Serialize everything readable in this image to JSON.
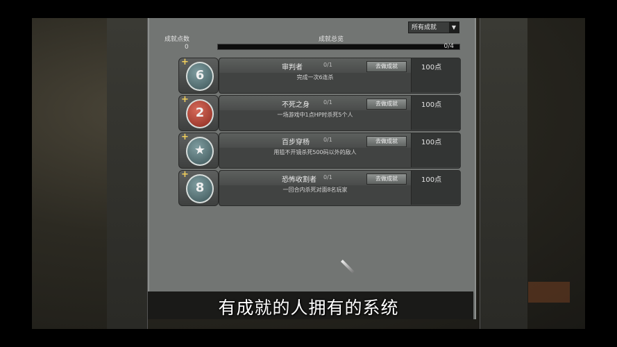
{
  "header": {
    "points_label": "成就点数",
    "points_value": "0",
    "progress_label": "成就总览",
    "progress_text": "0/4",
    "progress_fraction": 0
  },
  "filter": {
    "selected": "所有成就",
    "arrow_icon": "chevron-down-icon"
  },
  "achievements": [
    {
      "title": "审判者",
      "sub": "0/1",
      "desc": "完成一次6连杀",
      "button": "去做成就",
      "points": "100点",
      "badge_text": "6",
      "badge_color": "teal"
    },
    {
      "title": "不死之身",
      "sub": "0/1",
      "desc": "一场游戏中1点HP时杀死5个人",
      "button": "去做成就",
      "points": "100点",
      "badge_text": "2",
      "badge_color": "red"
    },
    {
      "title": "百步穿杨",
      "sub": "0/1",
      "desc": "用狙不开镜杀死500码以外的敌人",
      "button": "去做成就",
      "points": "100点",
      "badge_text": "★",
      "badge_color": "teal"
    },
    {
      "title": "恐怖收割者",
      "sub": "0/1",
      "desc": "一回合内杀死对面8名玩家",
      "button": "去做成就",
      "points": "100点",
      "badge_text": "8",
      "badge_color": "teal"
    }
  ],
  "subtitle": "有成就的人拥有的系统"
}
